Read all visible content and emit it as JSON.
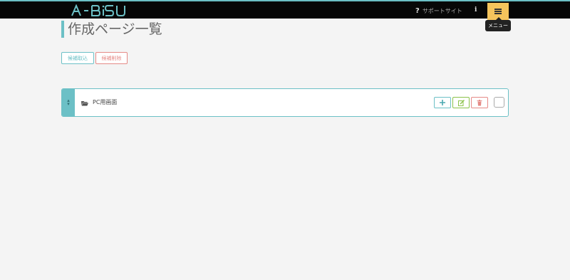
{
  "header": {
    "logo_text": "A-BiSU",
    "support_link": "サポートサイト",
    "menu_tooltip": "メニュー",
    "accent_color": "#6cc0c6",
    "menu_button_color": "#f5c45c"
  },
  "page": {
    "title": "作成ページ一覧",
    "import_button": "候補取込",
    "delete_button": "候補削除"
  },
  "pages_list": [
    {
      "label": "PC用画面",
      "icon": "folder-icon"
    }
  ]
}
